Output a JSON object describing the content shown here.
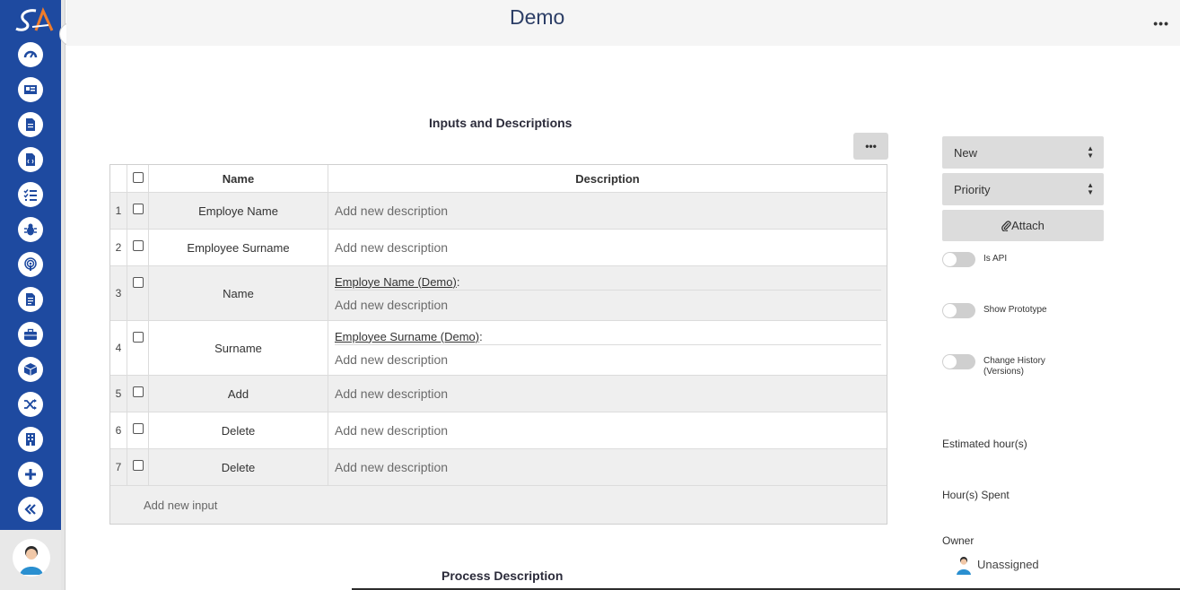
{
  "header": {
    "title": "Demo",
    "menu_label": "•••"
  },
  "sidebar": {
    "expand_glyph": "⇨",
    "icons": [
      "dashboard-icon",
      "id-card-icon",
      "document-icon",
      "code-file-icon",
      "task-list-icon",
      "bug-icon",
      "broadcast-icon",
      "file-text-icon",
      "briefcase-icon",
      "cube-icon",
      "shuffle-icon",
      "building-icon",
      "plus-icon",
      "double-chevron-left-icon"
    ]
  },
  "main": {
    "section_title": "Inputs and Descriptions",
    "table_menu_label": "•••",
    "table": {
      "headers": {
        "name": "Name",
        "description": "Description"
      },
      "rows": [
        {
          "num": "1",
          "name": "Employe Name",
          "ref": "",
          "desc_placeholder": "Add new description"
        },
        {
          "num": "2",
          "name": "Employee Surname",
          "ref": "",
          "desc_placeholder": "Add new description"
        },
        {
          "num": "3",
          "name": "Name",
          "ref": "Employe Name (Demo)",
          "desc_placeholder": "Add new description"
        },
        {
          "num": "4",
          "name": "Surname",
          "ref": "Employee Surname (Demo)",
          "desc_placeholder": "Add new description"
        },
        {
          "num": "5",
          "name": "Add",
          "ref": "",
          "desc_placeholder": "Add new description"
        },
        {
          "num": "6",
          "name": "Delete",
          "ref": "",
          "desc_placeholder": "Add new description"
        },
        {
          "num": "7",
          "name": "Delete",
          "ref": "",
          "desc_placeholder": "Add new description"
        }
      ],
      "add_input_label": "Add new input"
    },
    "process_title": "Process Description"
  },
  "right_panel": {
    "status_select": "New",
    "priority_select": "Priority",
    "attach_label": "Attach",
    "toggles": [
      {
        "label": "Is API"
      },
      {
        "label": "Show Prototype"
      },
      {
        "label": "Change History (Versions)"
      }
    ],
    "estimated_label": "Estimated hour(s)",
    "spent_label": "Hour(s) Spent",
    "owner_label": "Owner",
    "owner_value": "Unassigned"
  },
  "colors": {
    "sidebar": "#1e4aa0",
    "title": "#2c3e66",
    "accent_logo": "#f07c2a"
  }
}
